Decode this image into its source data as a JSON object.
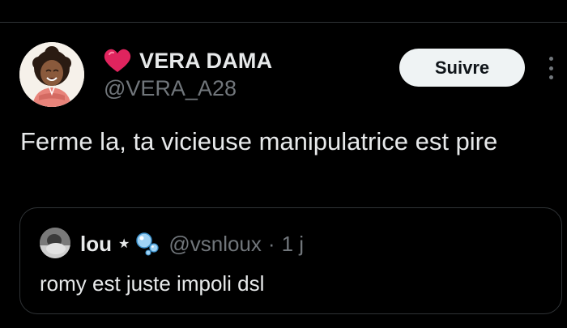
{
  "tweet": {
    "author": {
      "display_name": "VERA DAMA",
      "handle": "@VERA_A28",
      "name_emoji_icon": "red-heart-icon",
      "avatar_icon": "cartoon-avatar-icon"
    },
    "follow_label": "Suivre",
    "text": "Ferme la, ta vicieuse manipulatrice est pire"
  },
  "quote": {
    "display_name": "lou",
    "badge_icons": [
      "star-icon",
      "bubbles-icon"
    ],
    "star_glyph": "★",
    "handle": "@vsnloux",
    "separator": "·",
    "time": "1 j",
    "text": "romy est juste impoli dsl"
  },
  "colors": {
    "background": "#000000",
    "text_primary": "#e7e9ea",
    "text_secondary": "#71767b",
    "border": "#2f3336",
    "follow_bg": "#eff3f4",
    "heart": "#e0245e"
  }
}
